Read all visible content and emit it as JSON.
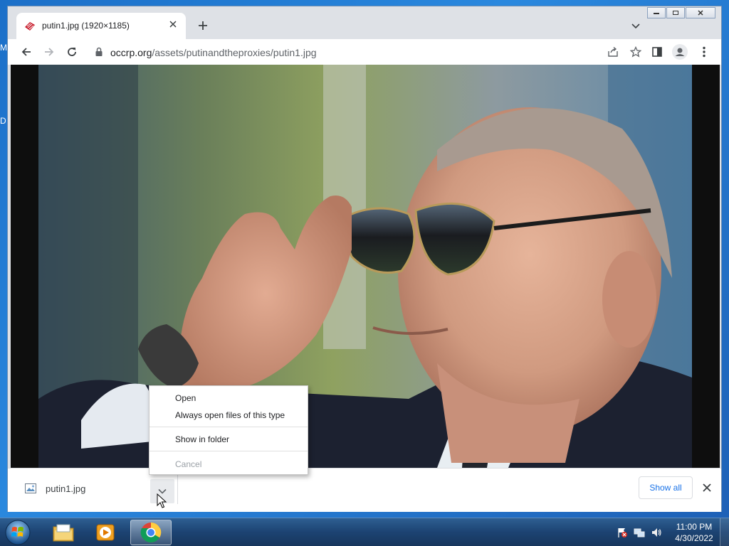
{
  "window": {
    "tab_title": "putin1.jpg (1920×1185)",
    "url_host": "occrp.org",
    "url_path": "/assets/putinandtheproxies/putin1.jpg"
  },
  "desktop": {
    "fragment_1": "M",
    "fragment_2": "D"
  },
  "download_shelf": {
    "file_name": "putin1.jpg",
    "show_all_label": "Show all"
  },
  "context_menu": {
    "items": [
      {
        "label": "Open"
      },
      {
        "label": "Always open files of this type"
      },
      {
        "label": "Show in folder"
      },
      {
        "label": "Cancel",
        "disabled": true
      }
    ]
  },
  "taskbar": {
    "apps": [
      {
        "icon": "file-explorer-icon"
      },
      {
        "icon": "media-player-icon"
      },
      {
        "icon": "chrome-icon",
        "active": true
      }
    ],
    "clock_time": "11:00 PM",
    "clock_date": "4/30/2022"
  },
  "colors": {
    "chrome_frame": "#dee1e6",
    "link_blue": "#1a73e8",
    "taskbar": "#1c4372"
  }
}
